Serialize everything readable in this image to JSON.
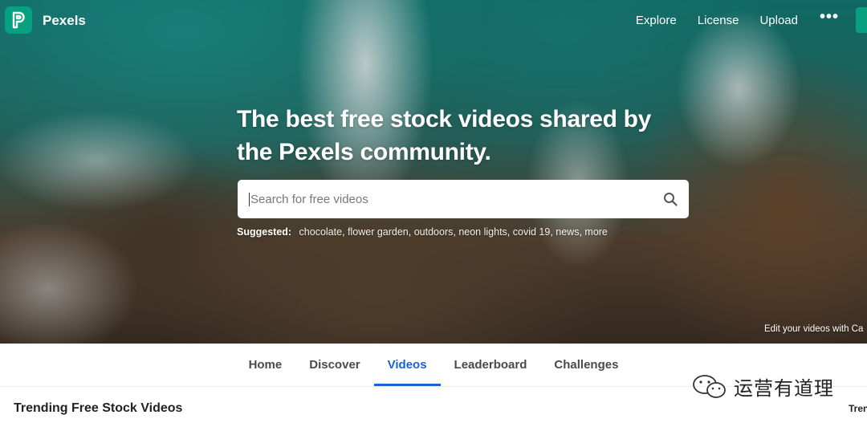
{
  "brand": {
    "name": "Pexels",
    "accent": "#07a081"
  },
  "nav": {
    "links": [
      "Explore",
      "License",
      "Upload"
    ],
    "more_icon": "more-dots-icon"
  },
  "hero": {
    "headline": "The best free stock videos shared by the Pexels community.",
    "search_placeholder": "Search for free videos",
    "suggested_label": "Suggested:",
    "suggestions": [
      "chocolate",
      "flower garden",
      "outdoors",
      "neon lights",
      "covid 19",
      "news",
      "more"
    ],
    "edit_note": "Edit your videos with Ca"
  },
  "tabs": {
    "items": [
      "Home",
      "Discover",
      "Videos",
      "Leaderboard",
      "Challenges"
    ],
    "active": "Videos",
    "active_color": "#1d5fd6"
  },
  "section": {
    "title": "Trending Free Stock Videos",
    "sort_label": "Tren"
  },
  "watermark": {
    "text": "运营有道理"
  }
}
